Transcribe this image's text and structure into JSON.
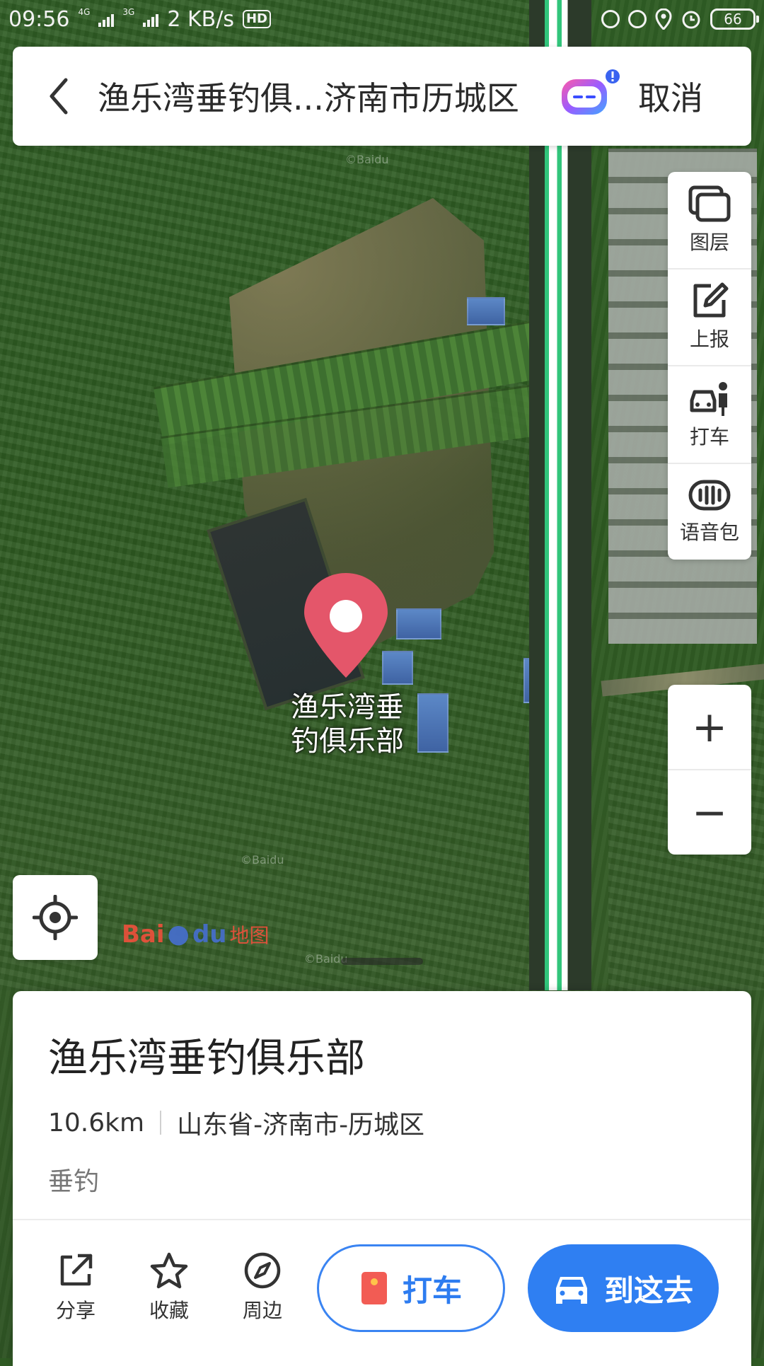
{
  "status_bar": {
    "time": "09:56",
    "network_tag_1": "4G",
    "network_tag_2": "3G",
    "speed": "2 KB/s",
    "hd": "HD",
    "battery": "66"
  },
  "search": {
    "title": "渔乐湾垂钓俱...济南市历城区",
    "cancel_label": "取消"
  },
  "tools": [
    {
      "label": "图层",
      "icon": "layers-icon"
    },
    {
      "label": "上报",
      "icon": "report-edit-icon"
    },
    {
      "label": "打车",
      "icon": "taxi-person-icon"
    },
    {
      "label": "语音包",
      "icon": "voice-pack-icon"
    }
  ],
  "zoom": {
    "in": "+",
    "out": "−"
  },
  "map": {
    "pin_label": "渔乐湾垂钓俱乐部",
    "watermark": "©Baidu",
    "logo_prefix": "Bai",
    "logo_mid": "du",
    "logo_suffix": "地图"
  },
  "place": {
    "name": "渔乐湾垂钓俱乐部",
    "distance": "10.6km",
    "address": "山东省-济南市-历城区",
    "category": "垂钓"
  },
  "actions": {
    "share": "分享",
    "favorite": "收藏",
    "nearby": "周边",
    "taxi": "打车",
    "go": "到这去"
  },
  "colors": {
    "primary_blue": "#2f7ff2",
    "pin_red": "#e4566a",
    "route_green": "#31c57b"
  }
}
